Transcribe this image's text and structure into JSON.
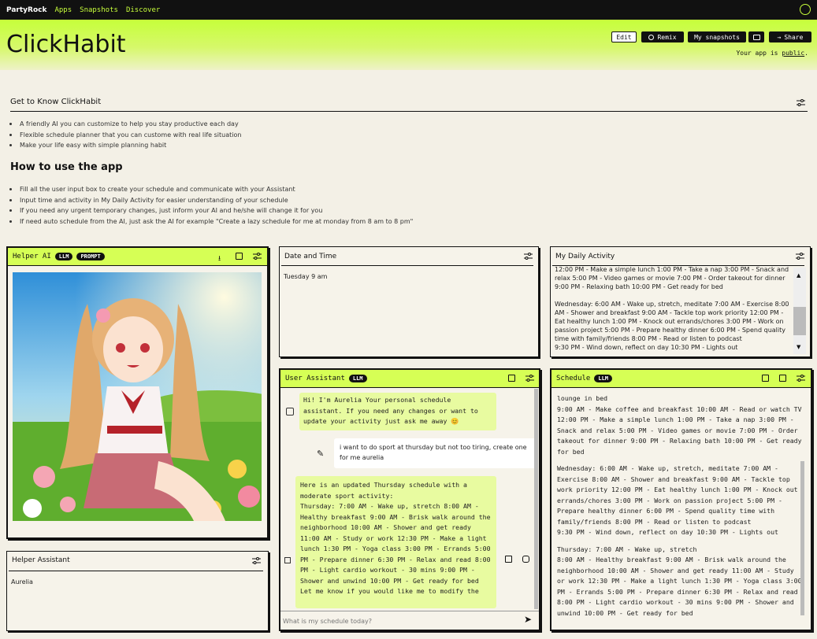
{
  "topbar": {
    "logo": "PartyRock",
    "nav": [
      "Apps",
      "Snapshots",
      "Discover"
    ]
  },
  "header": {
    "title": "ClickHabit",
    "edit": "Edit",
    "remix": "Remix",
    "snapshots": "My snapshots",
    "share": "Share",
    "public_text": "Your app is ",
    "public_link": "public",
    "public_end": "."
  },
  "intro": {
    "title": "Get to Know ClickHabit",
    "bullets": [
      "A friendly AI you can customize to help you stay productive each day",
      "Flexible schedule planner that you can custome with real life situation",
      "Make your life easy with simple planning habit"
    ],
    "howto": "How to use the app",
    "how_bullets": [
      "Fill all the user input box to create your schedule and communicate with your Assistant",
      "Input time and activity in My Daily Activity for easier understanding of your schedule",
      "If you need any urgent temporary changes, just inform your AI and he/she will change it for you",
      "If need auto schedule from the AI, just ask the AI for example \"Create a lazy schedule for me at monday from 8 am to 8 pm\""
    ]
  },
  "helper_ai": {
    "title": "Helper AI",
    "badges": [
      "LLM",
      "PROMPT"
    ]
  },
  "helper_assistant": {
    "title": "Helper Assistant",
    "value": "Aurelia"
  },
  "date_time": {
    "title": "Date and Time",
    "value": "Tuesday 9 am"
  },
  "daily": {
    "title": "My Daily Activity",
    "text1": "12:00 PM - Make a simple lunch 1:00 PM - Take a nap 3:00 PM - Snack and relax 5:00 PM - Video games or movie 7:00 PM - Order takeout for dinner 9:00 PM - Relaxing bath 10:00 PM - Get ready for bed",
    "text2": "Wednesday: 6:00 AM - Wake up, stretch, meditate 7:00 AM - Exercise 8:00 AM - Shower and breakfast 9:00 AM - Tackle top work priority 12:00 PM - Eat healthy lunch 1:00 PM - Knock out errands/chores 3:00 PM - Work on passion project 5:00 PM - Prepare healthy dinner 6:00 PM - Spend quality time with family/friends 8:00 PM - Read or listen to podcast",
    "text3": "9:30 PM - Wind down, reflect on day 10:30 PM - Lights out"
  },
  "assistant": {
    "title": "User Assistant",
    "badge": "LLM",
    "msg1": "Hi! I'm Aurelia Your personal schedule assistant. If you need any changes or want to update your activity just ask me away 😊",
    "user_msg": "i want to do sport at thursday but not too tiring, create one for me aurelia",
    "msg2": "Here is an updated Thursday schedule with a moderate sport activity:\nThursday: 7:00 AM - Wake up, stretch 8:00 AM - Healthy breakfast 9:00 AM - Brisk walk around the neighborhood 10:00 AM - Shower and get ready 11:00 AM - Study or work 12:30 PM - Make a light lunch 1:30 PM - Yoga class 3:00 PM - Errands 5:00 PM - Prepare dinner 6:30 PM - Relax and read 8:00 PM - Light cardio workout - 30 mins 9:00 PM - Shower and unwind 10:00 PM - Get ready for bed\nLet me know if you would like me to modify the",
    "placeholder": "What is my schedule today?"
  },
  "schedule": {
    "title": "Schedule",
    "badge": "LLM",
    "p1": "lounge in bed\n9:00 AM - Make coffee and breakfast 10:00 AM - Read or watch TV 12:00 PM - Make a simple lunch 1:00 PM - Take a nap 3:00 PM - Snack and relax 5:00 PM - Video games or movie 7:00 PM - Order takeout for dinner 9:00 PM - Relaxing bath 10:00 PM - Get ready for bed",
    "p2": "Wednesday: 6:00 AM - Wake up, stretch, meditate 7:00 AM - Exercise 8:00 AM - Shower and breakfast 9:00 AM - Tackle top work priority 12:00 PM - Eat healthy lunch 1:00 PM - Knock out errands/chores 3:00 PM - Work on passion project 5:00 PM - Prepare healthy dinner 6:00 PM - Spend quality time with family/friends 8:00 PM - Read or listen to podcast\n9:30 PM - Wind down, reflect on day 10:30 PM - Lights out",
    "p3": "Thursday: 7:00 AM - Wake up, stretch\n8:00 AM - Healthy breakfast 9:00 AM - Brisk walk around the neighborhood 10:00 AM - Shower and get ready 11:00 AM - Study or work 12:30 PM - Make a light lunch 1:30 PM - Yoga class 3:00 PM - Errands 5:00 PM - Prepare dinner 6:30 PM - Relax and read 8:00 PM - Light cardio workout - 30 mins 9:00 PM - Shower and unwind 10:00 PM - Get ready for bed"
  },
  "colors": {
    "accent": "#c8ff3c",
    "card_header": "#d6ff55",
    "bubble": "#e8fba0",
    "dark": "#111111"
  }
}
